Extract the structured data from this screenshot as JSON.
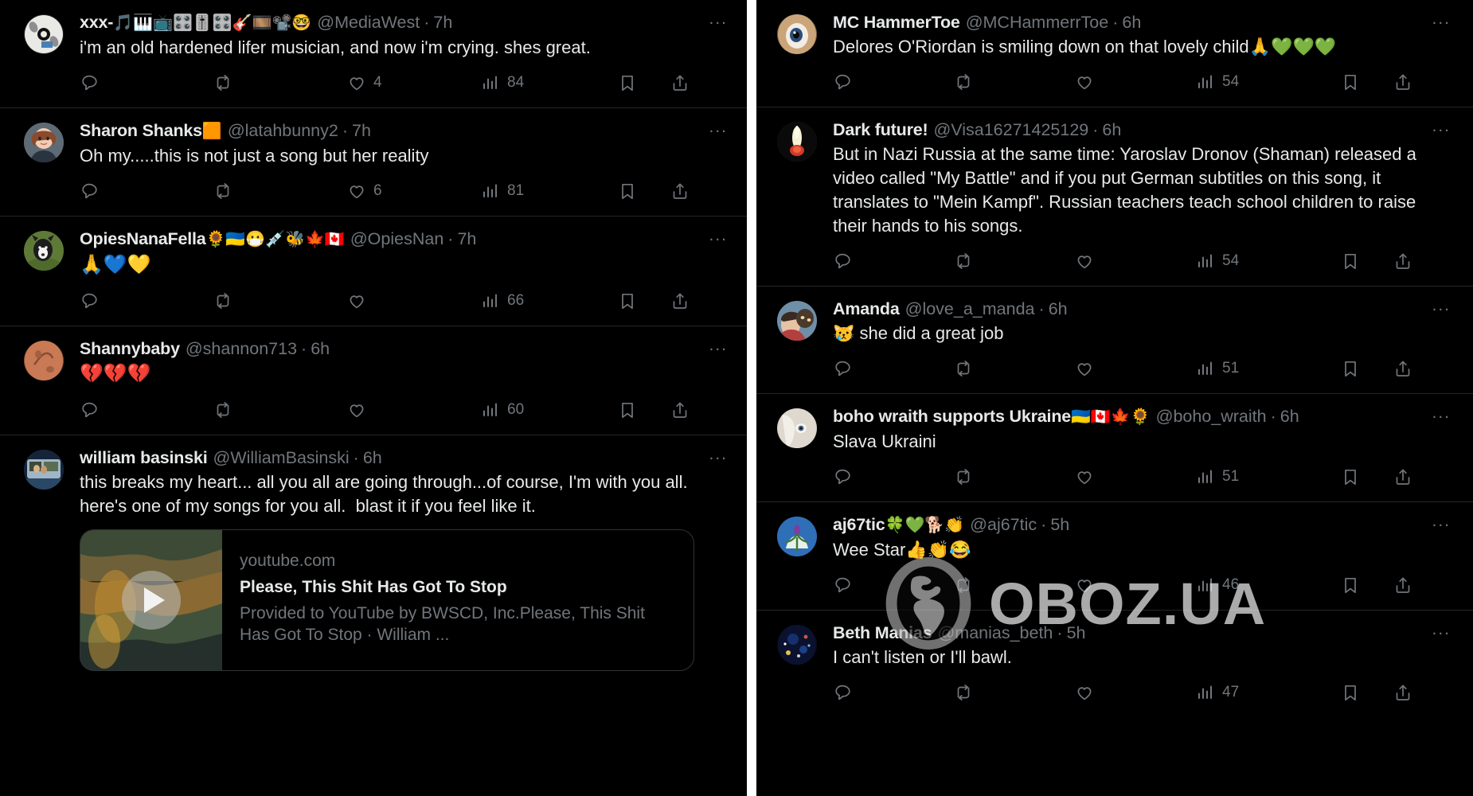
{
  "watermark": {
    "text": "OBOZ.UA",
    "icon": "globe-icon"
  },
  "icons": {
    "reply": "reply-icon",
    "retweet": "retweet-icon",
    "like": "like-icon",
    "views": "views-icon",
    "bookmark": "bookmark-icon",
    "share": "share-icon",
    "more": "more-options-icon"
  },
  "colors": {
    "background": "#000000",
    "text": "#e7e9ea",
    "muted": "#71767b",
    "divider": "#242628",
    "card_border": "#2f3336"
  },
  "left_panel": {
    "tweets": [
      {
        "display_name": "xxx-",
        "name_emoji": "🎵🎹📺🎛️🎚️🎛️🎸🎞️📽️🤓",
        "handle": "@MediaWest",
        "time": "7h",
        "separator": "·",
        "text": "i'm an old hardened lifer musician, and now i'm crying. shes great.",
        "emoji_line": "",
        "more": "...",
        "actions": {
          "reply": "",
          "retweet": "",
          "like": "4",
          "views": "84"
        }
      },
      {
        "display_name": "Sharon Shanks",
        "name_emoji": "🟧",
        "handle": "@latahbunny2",
        "time": "7h",
        "separator": "·",
        "text": "Oh my.....this is not just a song but her reality",
        "emoji_line": "",
        "more": "...",
        "actions": {
          "reply": "",
          "retweet": "",
          "like": "6",
          "views": "81"
        }
      },
      {
        "display_name": "OpiesNanaFella",
        "name_emoji": "🌻🇺🇦😷💉🐝🍁🇨🇦",
        "handle": "@OpiesNan",
        "time": "7h",
        "separator": "·",
        "text": "",
        "emoji_line": "🙏💙💛",
        "more": "...",
        "actions": {
          "reply": "",
          "retweet": "",
          "like": "",
          "views": "66"
        }
      },
      {
        "display_name": "Shannybaby",
        "name_emoji": "",
        "handle": "@shannon713",
        "time": "6h",
        "separator": "·",
        "text": "",
        "emoji_line": "💔💔💔",
        "more": "...",
        "actions": {
          "reply": "",
          "retweet": "",
          "like": "",
          "views": "60"
        }
      },
      {
        "display_name": "william basinski",
        "name_emoji": "",
        "handle": "@WilliamBasinski",
        "time": "6h",
        "separator": "·",
        "text": "this breaks my heart... all you all are going through...of course, I'm with you all. here's one of my songs for you all.  blast it if you feel like it.",
        "emoji_line": "",
        "more": "...",
        "card": {
          "domain": "youtube.com",
          "title": "Please, This Shit Has Got To Stop",
          "description": "Provided to YouTube by BWSCD, Inc.Please, This Shit Has Got To Stop · William ...",
          "play_icon": "play-icon"
        },
        "actions": null
      }
    ]
  },
  "right_panel": {
    "tweets": [
      {
        "display_name": "MC HammerToe",
        "name_emoji": "",
        "handle": "@MCHammerrToe",
        "time": "6h",
        "separator": "·",
        "text": "Delores O'Riordan is smiling down on that lovely child🙏💚💚💚",
        "emoji_line": "",
        "more": "...",
        "actions": {
          "reply": "",
          "retweet": "",
          "like": "",
          "views": "54"
        }
      },
      {
        "display_name": "Dark future!",
        "name_emoji": "",
        "handle": "@Visa16271425129",
        "time": "6h",
        "separator": "·",
        "text": "But in Nazi Russia at the same time: Yaroslav Dronov (Shaman) released a video called \"My Battle\" and if you put German subtitles on this song, it translates to \"Mein Kampf\". Russian teachers teach school children to raise their hands to his songs.",
        "emoji_line": "",
        "more": "...",
        "actions": {
          "reply": "",
          "retweet": "",
          "like": "",
          "views": "54"
        }
      },
      {
        "display_name": "Amanda",
        "name_emoji": "",
        "handle": "@love_a_manda",
        "time": "6h",
        "separator": "·",
        "text": "😿 she did a great job",
        "emoji_line": "",
        "more": "...",
        "actions": {
          "reply": "",
          "retweet": "",
          "like": "",
          "views": "51"
        }
      },
      {
        "display_name": "boho wraith supports Ukraine",
        "name_emoji": "🇺🇦🇨🇦🍁🌻",
        "handle": "@boho_wraith",
        "time": "6h",
        "separator": "·",
        "text": "Slava Ukraini",
        "emoji_line": "",
        "more": "...",
        "actions": {
          "reply": "",
          "retweet": "",
          "like": "",
          "views": "51"
        }
      },
      {
        "display_name": "aj67tic",
        "name_emoji": "🍀💚🐕👏",
        "handle": "@aj67tic",
        "time": "5h",
        "separator": "·",
        "text": "Wee Star👍👏😂",
        "emoji_line": "",
        "more": "...",
        "actions": {
          "reply": "",
          "retweet": "",
          "like": "",
          "views": "46"
        }
      },
      {
        "display_name": "Beth Manias",
        "name_emoji": "",
        "handle": "@manias_beth",
        "time": "5h",
        "separator": "·",
        "text": "I can't listen or I'll bawl.",
        "emoji_line": "",
        "more": "...",
        "actions": {
          "reply": "",
          "retweet": "",
          "like": "",
          "views": "47"
        }
      }
    ]
  }
}
